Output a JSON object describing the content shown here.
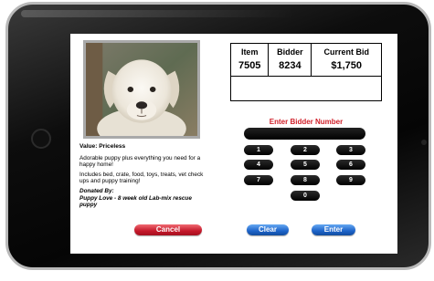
{
  "item_table": {
    "headers": [
      "Item",
      "Bidder",
      "Current Bid"
    ],
    "values": [
      "7505",
      "8234",
      "$1,750"
    ]
  },
  "item": {
    "value_label": "Value: Priceless",
    "description_1": "Adorable puppy plus everything you need for a happy home!",
    "description_2": "Includes bed, crate, food, toys, treats, vet check ups and puppy training!",
    "donated_label": "Donated By:",
    "donated_by": "Puppy Love - 8 week old Lab-mix rescue puppy"
  },
  "bidder_entry": {
    "label": "Enter Bidder Number",
    "value": ""
  },
  "keypad": [
    "1",
    "2",
    "3",
    "4",
    "5",
    "6",
    "7",
    "8",
    "9",
    "0"
  ],
  "buttons": {
    "cancel": "Cancel",
    "clear": "Clear",
    "enter": "Enter"
  }
}
